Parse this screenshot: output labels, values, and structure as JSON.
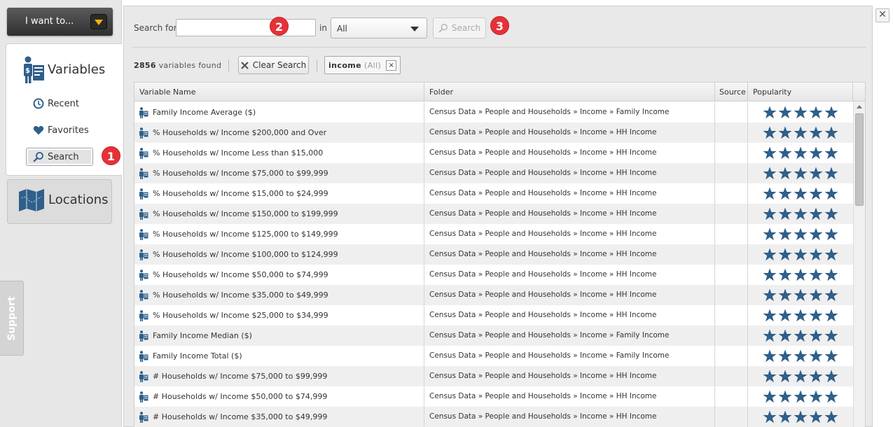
{
  "left": {
    "i_want_label": "I want to...",
    "variables_title": "Variables",
    "nav": {
      "recent": "Recent",
      "favorites": "Favorites",
      "search": "Search"
    },
    "locations_title": "Locations",
    "support_label": "Support"
  },
  "search": {
    "search_for_label": "Search for",
    "input_value": "",
    "in_label": "in",
    "scope_value": "All",
    "button_label": "Search"
  },
  "results": {
    "count": "2856",
    "count_suffix": "variables found",
    "clear_label": "Clear Search",
    "filter_term": "income",
    "filter_scope": "(All)",
    "filter_remove": "×"
  },
  "badges": [
    "1",
    "2",
    "3"
  ],
  "close_glyph": "✕",
  "colors": {
    "star": "#2f5f8a",
    "badge": "#e53238",
    "person_icon": "#2f5f8a"
  },
  "table": {
    "columns": [
      "Variable Name",
      "Folder",
      "Source",
      "Popularity"
    ],
    "rows": [
      {
        "name": "Family Income Average ($)",
        "folder": "Census Data » People and Households » Income » Family Income",
        "source": "",
        "stars": 5
      },
      {
        "name": "% Households w/ Income $200,000 and Over",
        "folder": "Census Data » People and Households » Income » HH Income",
        "source": "",
        "stars": 5
      },
      {
        "name": "% Households w/ Income Less than $15,000",
        "folder": "Census Data » People and Households » Income » HH Income",
        "source": "",
        "stars": 5
      },
      {
        "name": "% Households w/ Income $75,000 to $99,999",
        "folder": "Census Data » People and Households » Income » HH Income",
        "source": "",
        "stars": 5
      },
      {
        "name": "% Households w/ Income $15,000 to $24,999",
        "folder": "Census Data » People and Households » Income » HH Income",
        "source": "",
        "stars": 5
      },
      {
        "name": "% Households w/ Income $150,000 to $199,999",
        "folder": "Census Data » People and Households » Income » HH Income",
        "source": "",
        "stars": 5
      },
      {
        "name": "% Households w/ Income $125,000 to $149,999",
        "folder": "Census Data » People and Households » Income » HH Income",
        "source": "",
        "stars": 5
      },
      {
        "name": "% Households w/ Income $100,000 to $124,999",
        "folder": "Census Data » People and Households » Income » HH Income",
        "source": "",
        "stars": 5
      },
      {
        "name": "% Households w/ Income $50,000 to $74,999",
        "folder": "Census Data » People and Households » Income » HH Income",
        "source": "",
        "stars": 5
      },
      {
        "name": "% Households w/ Income $35,000 to $49,999",
        "folder": "Census Data » People and Households » Income » HH Income",
        "source": "",
        "stars": 5
      },
      {
        "name": "% Households w/ Income $25,000 to $34,999",
        "folder": "Census Data » People and Households » Income » HH Income",
        "source": "",
        "stars": 5
      },
      {
        "name": "Family Income Median ($)",
        "folder": "Census Data » People and Households » Income » Family Income",
        "source": "",
        "stars": 5
      },
      {
        "name": "Family Income Total ($)",
        "folder": "Census Data » People and Households » Income » Family Income",
        "source": "",
        "stars": 5
      },
      {
        "name": "# Households w/ Income $75,000 to $99,999",
        "folder": "Census Data » People and Households » Income » HH Income",
        "source": "",
        "stars": 5
      },
      {
        "name": "# Households w/ Income $50,000 to $74,999",
        "folder": "Census Data » People and Households » Income » HH Income",
        "source": "",
        "stars": 5
      },
      {
        "name": "# Households w/ Income $35,000 to $49,999",
        "folder": "Census Data » People and Households » Income » HH Income",
        "source": "",
        "stars": 5
      }
    ]
  }
}
